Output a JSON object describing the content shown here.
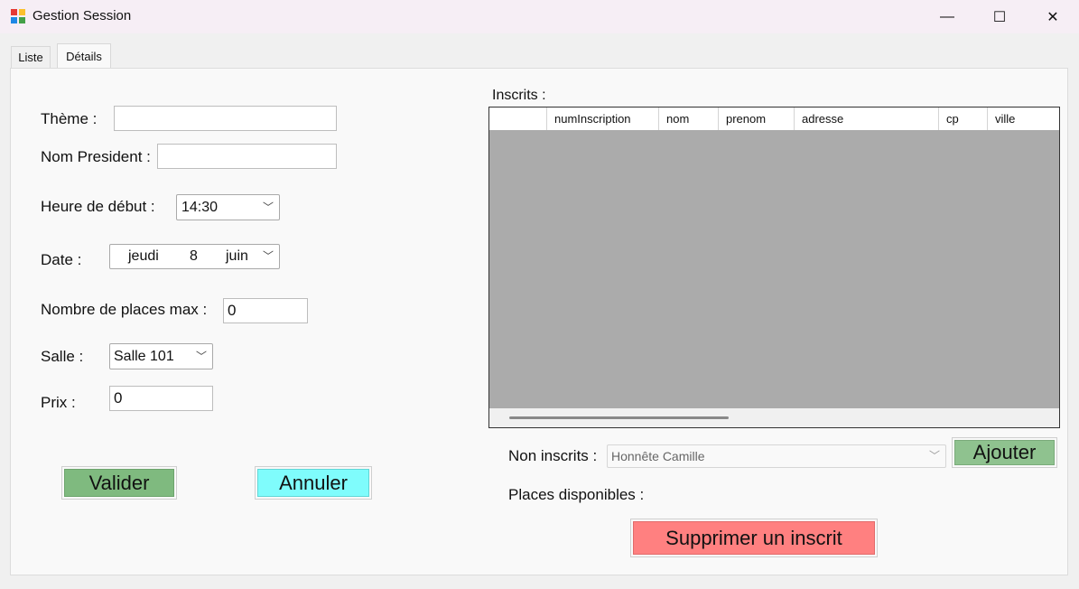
{
  "window": {
    "title": "Gestion Session",
    "minimize_glyph": "—",
    "maximize_glyph": "☐",
    "close_glyph": "✕"
  },
  "tabs": [
    {
      "label": "Liste"
    },
    {
      "label": "Détails"
    }
  ],
  "form": {
    "theme_label": "Thème :",
    "theme_value": "",
    "president_label": "Nom President :",
    "president_value": "",
    "heure_label": "Heure de début :",
    "heure_value": "14:30",
    "date_label": "Date :",
    "date_weekday": "jeudi",
    "date_day": "8",
    "date_month": "juin",
    "places_label": "Nombre de places max :",
    "places_value": "0",
    "salle_label": "Salle :",
    "salle_value": "Salle 101",
    "prix_label": "Prix :",
    "prix_value": "0",
    "valider_label": "Valider",
    "annuler_label": "Annuler"
  },
  "inscrits": {
    "label": "Inscrits :",
    "columns": [
      "",
      "numInscription",
      "nom",
      "prenom",
      "adresse",
      "cp",
      "ville"
    ]
  },
  "non_inscrits": {
    "label": "Non inscrits :",
    "selected": "Honnête Camille",
    "ajouter_label": "Ajouter"
  },
  "places_disponibles_label": "Places disponibles :",
  "supprimer_label": "Supprimer un inscrit",
  "colors": {
    "valider": "#7fba7f",
    "annuler": "#7ffcfc",
    "ajouter": "#8fc28f",
    "supprimer": "#ff8080",
    "grid_background": "#ababab"
  }
}
